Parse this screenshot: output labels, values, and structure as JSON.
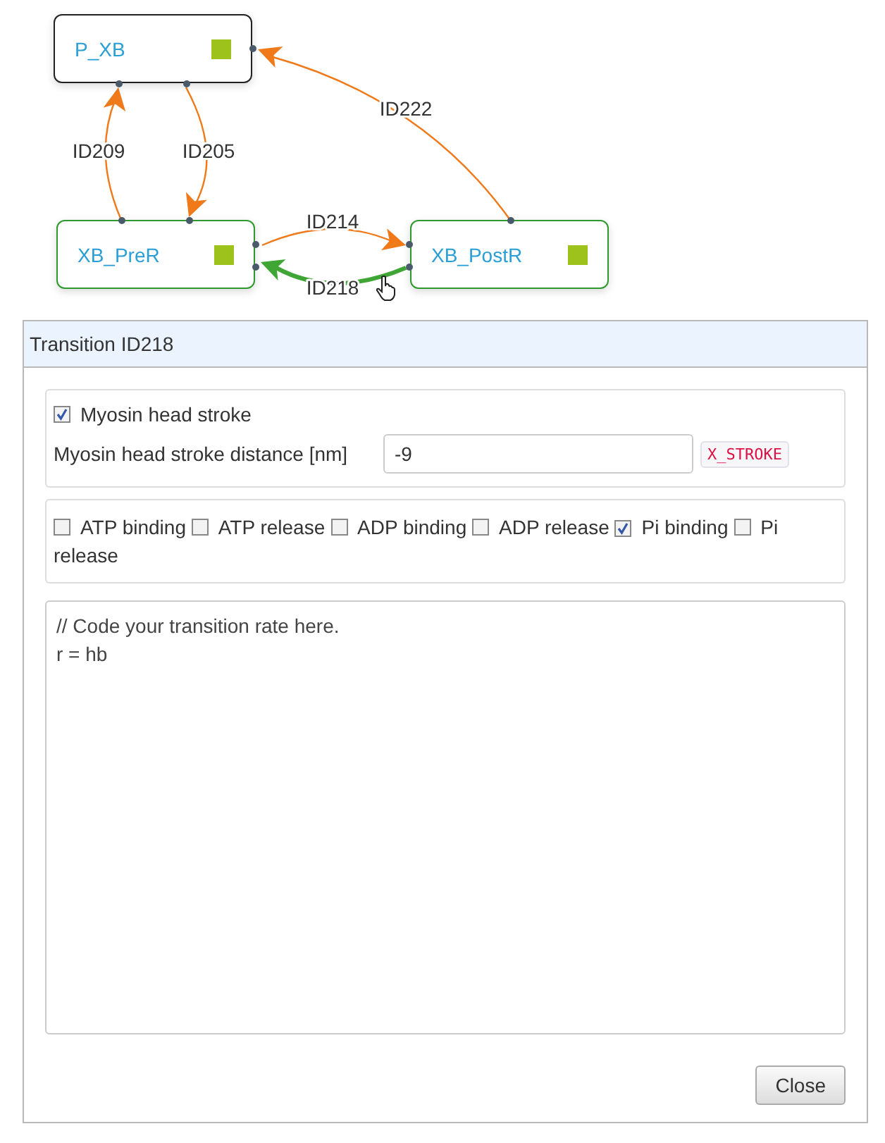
{
  "diagram": {
    "nodes": [
      {
        "label": "P_XB",
        "color": "#222222"
      },
      {
        "label": "XB_PreR",
        "color": "#2e9a2e"
      },
      {
        "label": "XB_PostR",
        "color": "#2e9a2e"
      }
    ],
    "edges": [
      {
        "label": "ID209",
        "selected": false
      },
      {
        "label": "ID205",
        "selected": false
      },
      {
        "label": "ID222",
        "selected": false
      },
      {
        "label": "ID214",
        "selected": false
      },
      {
        "label": "ID218",
        "selected": true
      }
    ]
  },
  "dialog": {
    "title": "Transition ID218",
    "stroke": {
      "label": "Myosin head stroke",
      "checked": true,
      "distance_label": "Myosin head stroke distance [nm]",
      "distance_value": "-9",
      "tag": "X_STROKE"
    },
    "options": [
      {
        "label": "ATP binding",
        "checked": false
      },
      {
        "label": "ATP release",
        "checked": false
      },
      {
        "label": "ADP binding",
        "checked": false
      },
      {
        "label": "ADP release",
        "checked": false
      },
      {
        "label": "Pi binding",
        "checked": true
      },
      {
        "label": "Pi release",
        "checked": false
      }
    ],
    "code_lines": [
      "// Code your transition rate here.",
      "r = hb"
    ],
    "close_button": "Close"
  }
}
